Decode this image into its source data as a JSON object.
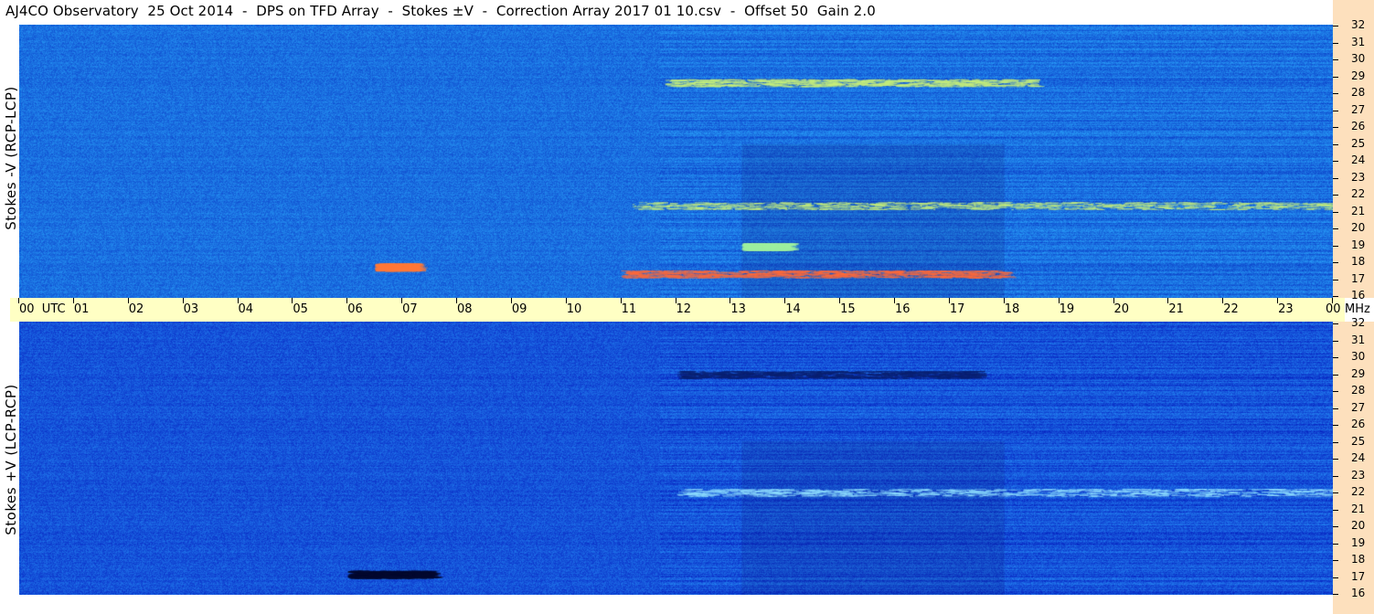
{
  "title": "AJ4CO Observatory  25 Oct 2014  -  DPS on TFD Array  -  Stokes ±V  -  Correction Array 2017 01 10.csv  -  Offset 50  Gain 2.0",
  "chart_data": [
    {
      "type": "heatmap",
      "ylabel": "Stokes -V (RCP-LCP)",
      "ylim": [
        16,
        32
      ],
      "xlim": [
        0,
        24
      ],
      "base_color": "#1a6fe0",
      "bands": [
        {
          "f": 28.6,
          "t0": 11.8,
          "t1": 18.5,
          "color": "#c8f07a"
        },
        {
          "f": 21.4,
          "t0": 11.2,
          "t1": 24,
          "color": "#c8f07a"
        },
        {
          "f": 17.8,
          "t0": 6.5,
          "t1": 7.2,
          "color": "#ff7a3a"
        },
        {
          "f": 17.4,
          "t0": 11.0,
          "t1": 18.0,
          "color": "#ff6a3a"
        },
        {
          "f": 19.0,
          "t0": 13.2,
          "t1": 14.0,
          "color": "#9ef0a0"
        }
      ]
    },
    {
      "type": "heatmap",
      "ylabel": "Stokes +V (LCP-RCP)",
      "ylim": [
        16,
        32
      ],
      "xlim": [
        0,
        24
      ],
      "base_color": "#1553d9",
      "bands": [
        {
          "f": 28.9,
          "t0": 12.0,
          "t1": 17.5,
          "color": "#0a2070"
        },
        {
          "f": 17.2,
          "t0": 6.0,
          "t1": 7.5,
          "color": "#050a30"
        },
        {
          "f": 22.0,
          "t0": 12.0,
          "t1": 24,
          "color": "#90e0ff"
        }
      ]
    }
  ],
  "time_axis": {
    "labels": [
      "00  UTC",
      "01",
      "02",
      "03",
      "04",
      "05",
      "06",
      "07",
      "08",
      "09",
      "10",
      "11",
      "12",
      "13",
      "14",
      "15",
      "16",
      "17",
      "18",
      "19",
      "20",
      "21",
      "22",
      "23",
      "00"
    ],
    "unit": "MHz"
  },
  "freq_axis": {
    "labels": [
      "32",
      "31",
      "30",
      "29",
      "28",
      "27",
      "26",
      "25",
      "24",
      "23",
      "22",
      "21",
      "20",
      "19",
      "18",
      "17",
      "16"
    ]
  }
}
